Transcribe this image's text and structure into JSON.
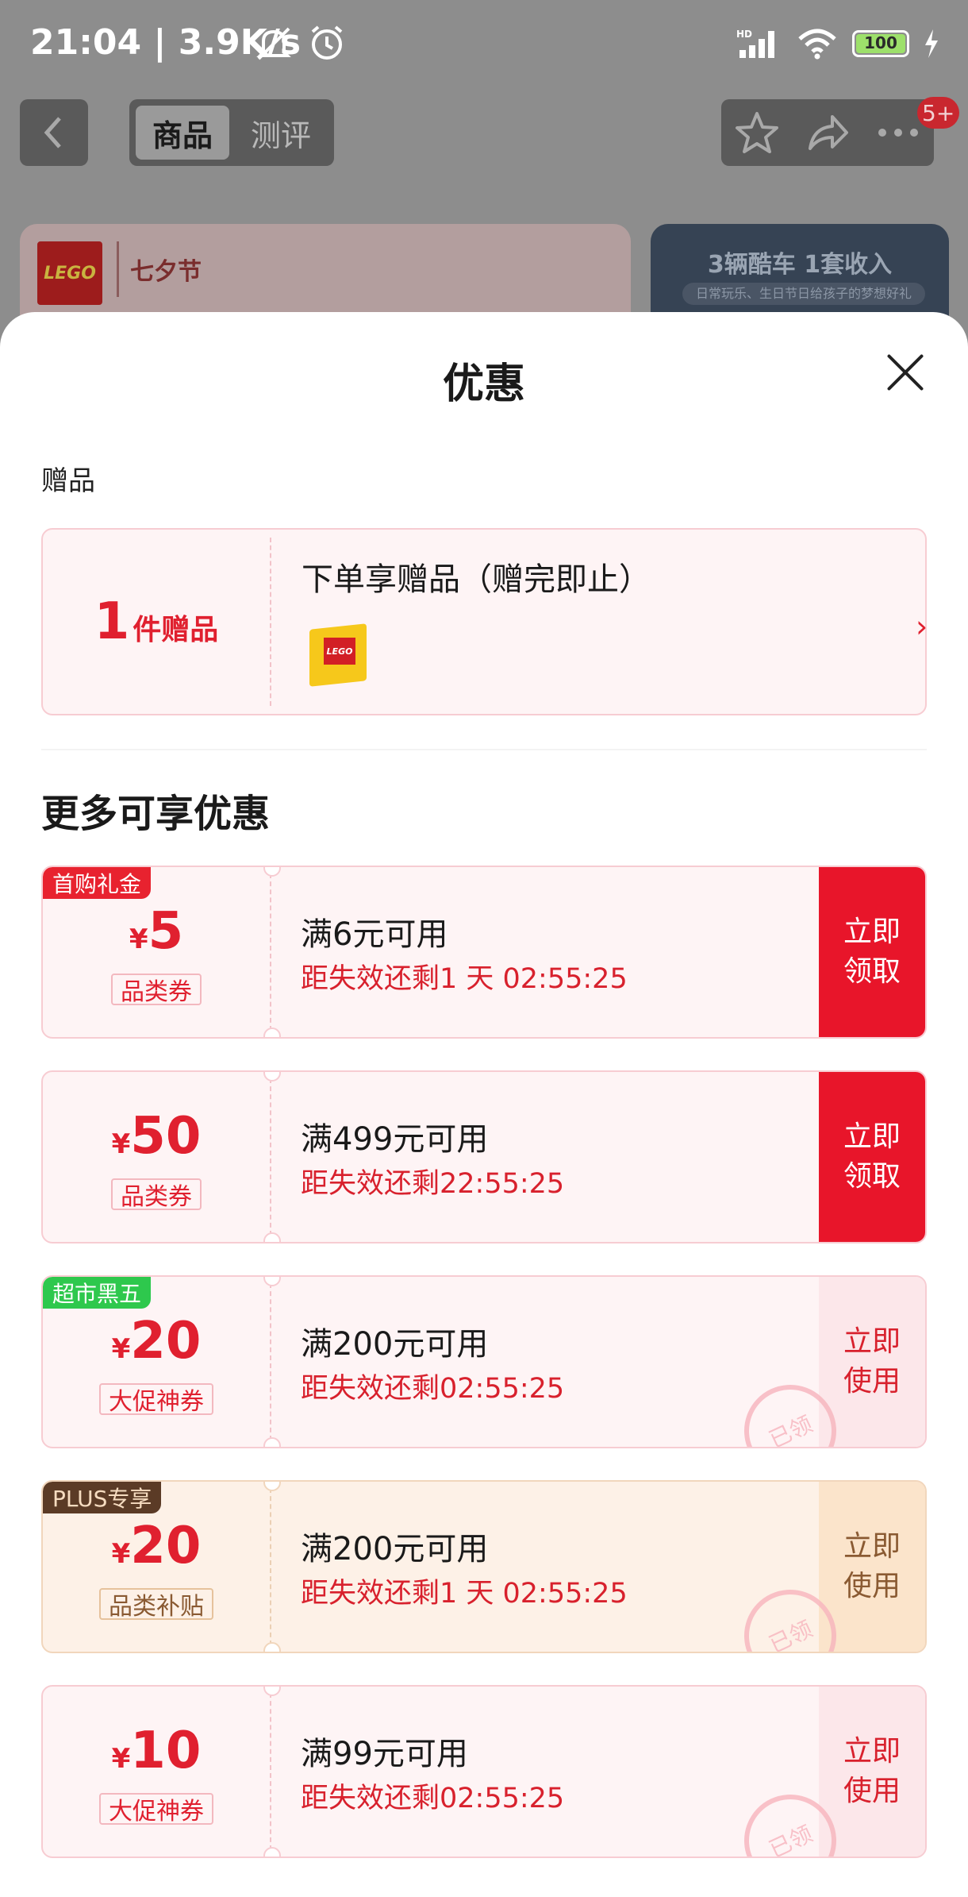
{
  "status_bar": {
    "time_speed": "21:04 | 3.9K/s",
    "network": "HD",
    "battery": "100"
  },
  "nav": {
    "tabs": [
      {
        "label": "商品",
        "active": true
      },
      {
        "label": "测评",
        "active": false
      }
    ],
    "more_badge": "5+"
  },
  "background_banners": {
    "left_logo": "LEGO",
    "left_festival": "七夕节",
    "right_title": "3辆酷车 1套收入",
    "right_subtitle": "日常玩乐、生日节日给孩子的梦想好礼"
  },
  "sheet": {
    "title": "优惠",
    "gift_section_label": "赠品",
    "gift": {
      "count": "1",
      "unit": "件赠品",
      "title": "下单享赠品（赠完即止）",
      "chevron": "›"
    },
    "more_title": "更多可享优惠",
    "coupons": [
      {
        "tag": "首购礼金",
        "tag_color": "#e8222f",
        "yen": "¥",
        "amount": "5",
        "type": "品类券",
        "condition": "满6元可用",
        "time": "距失效还剩1 天 02:55:25",
        "action": "立即领取",
        "action_line1": "立即",
        "action_line2": "领取",
        "state": "claim"
      },
      {
        "tag": "",
        "yen": "¥",
        "amount": "50",
        "type": "品类券",
        "condition": "满499元可用",
        "time": "距失效还剩22:55:25",
        "action_line1": "立即",
        "action_line2": "领取",
        "state": "claim"
      },
      {
        "tag": "超市黑五",
        "tag_color": "#2ec84d",
        "yen": "¥",
        "amount": "20",
        "type": "大促神券",
        "condition": "满200元可用",
        "time": "距失效还剩02:55:25",
        "action_line1": "立即",
        "action_line2": "使用",
        "stamp": "已领",
        "state": "use"
      },
      {
        "tag": "PLUS专享",
        "tag_color": "#5b3b26",
        "yen": "¥",
        "amount": "20",
        "type": "品类补贴",
        "condition": "满200元可用",
        "time": "距失效还剩1 天 02:55:25",
        "action_line1": "立即",
        "action_line2": "使用",
        "stamp": "已领",
        "state": "use"
      },
      {
        "tag": "",
        "yen": "¥",
        "amount": "10",
        "type": "大促神券",
        "condition": "满99元可用",
        "time": "距失效还剩02:55:25",
        "action_line1": "立即",
        "action_line2": "使用",
        "stamp": "已领",
        "state": "use"
      }
    ]
  }
}
